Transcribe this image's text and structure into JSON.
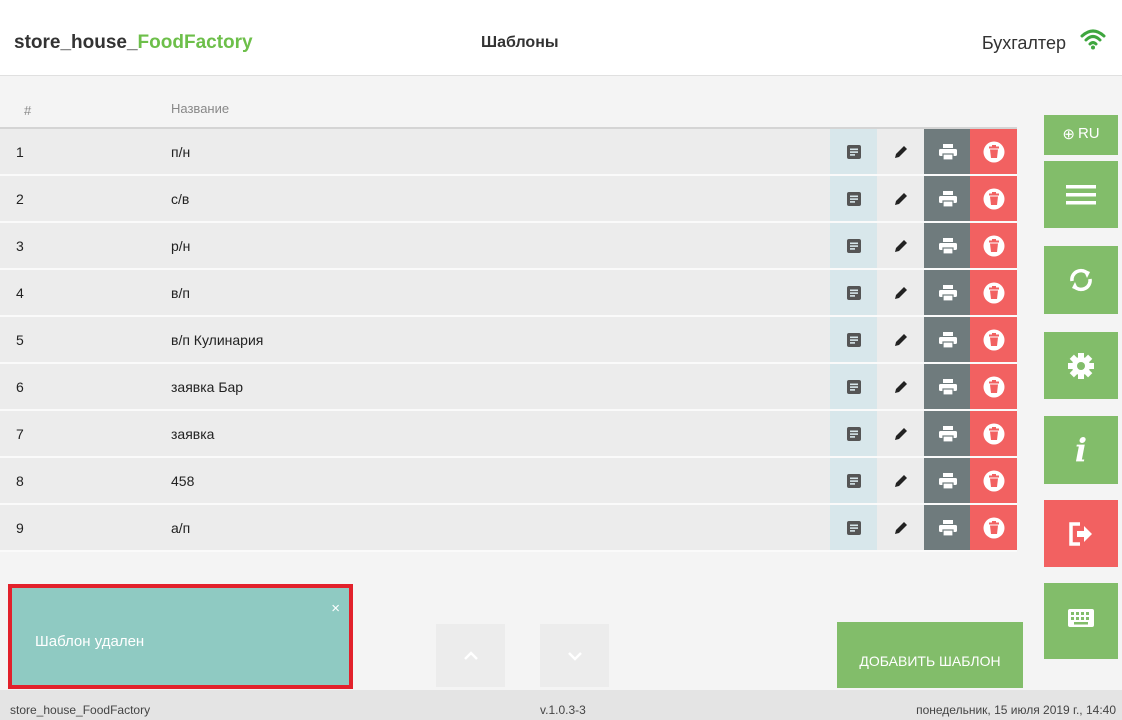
{
  "header": {
    "brand_prefix": "store_house_",
    "brand_accent": "FoodFactory",
    "title": "Шаблоны",
    "user_role": "Бухгалтер",
    "accent_color": "#6dbf4a"
  },
  "table": {
    "col_num": "#",
    "col_name": "Название",
    "rows": [
      {
        "num": "1",
        "name": "п/н"
      },
      {
        "num": "2",
        "name": "с/в"
      },
      {
        "num": "3",
        "name": "р/н"
      },
      {
        "num": "4",
        "name": "в/п"
      },
      {
        "num": "5",
        "name": "в/п Кулинария"
      },
      {
        "num": "6",
        "name": "заявка Бар"
      },
      {
        "num": "7",
        "name": "заявка"
      },
      {
        "num": "8",
        "name": "458"
      },
      {
        "num": "9",
        "name": "а/п"
      }
    ],
    "row_actions": [
      "document-icon",
      "pencil-icon",
      "printer-icon",
      "trash-icon"
    ]
  },
  "sidebar": {
    "language": "RU",
    "buttons": [
      "menu-icon",
      "sync-icon",
      "gear-icon",
      "info-icon",
      "logout-icon",
      "keyboard-icon"
    ]
  },
  "toast": {
    "message": "Шаблон удален",
    "close": "×"
  },
  "actions": {
    "add_template": "ДОБАВИТЬ ШАБЛОН"
  },
  "footer": {
    "app_name": "store_house_FoodFactory",
    "version": "v.1.0.3-3",
    "datetime": "понедельник, 15 июля 2019 г., 14:40"
  }
}
